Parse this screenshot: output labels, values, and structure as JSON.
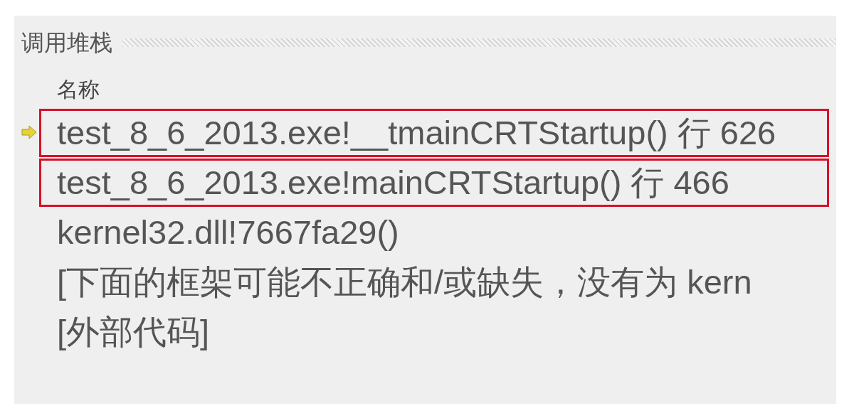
{
  "panel": {
    "title": "调用堆栈"
  },
  "columns": [
    "名称"
  ],
  "frames": [
    {
      "text": "test_8_6_2013.exe!__tmainCRTStartup() 行 626",
      "current": true,
      "highlighted": true
    },
    {
      "text": "test_8_6_2013.exe!mainCRTStartup() 行 466",
      "current": false,
      "highlighted": true
    },
    {
      "text": "kernel32.dll!7667fa29()",
      "current": false,
      "highlighted": false
    },
    {
      "text": "[下面的框架可能不正确和/或缺失，没有为 kern",
      "current": false,
      "highlighted": false
    },
    {
      "text": "[外部代码]",
      "current": false,
      "highlighted": false
    }
  ]
}
